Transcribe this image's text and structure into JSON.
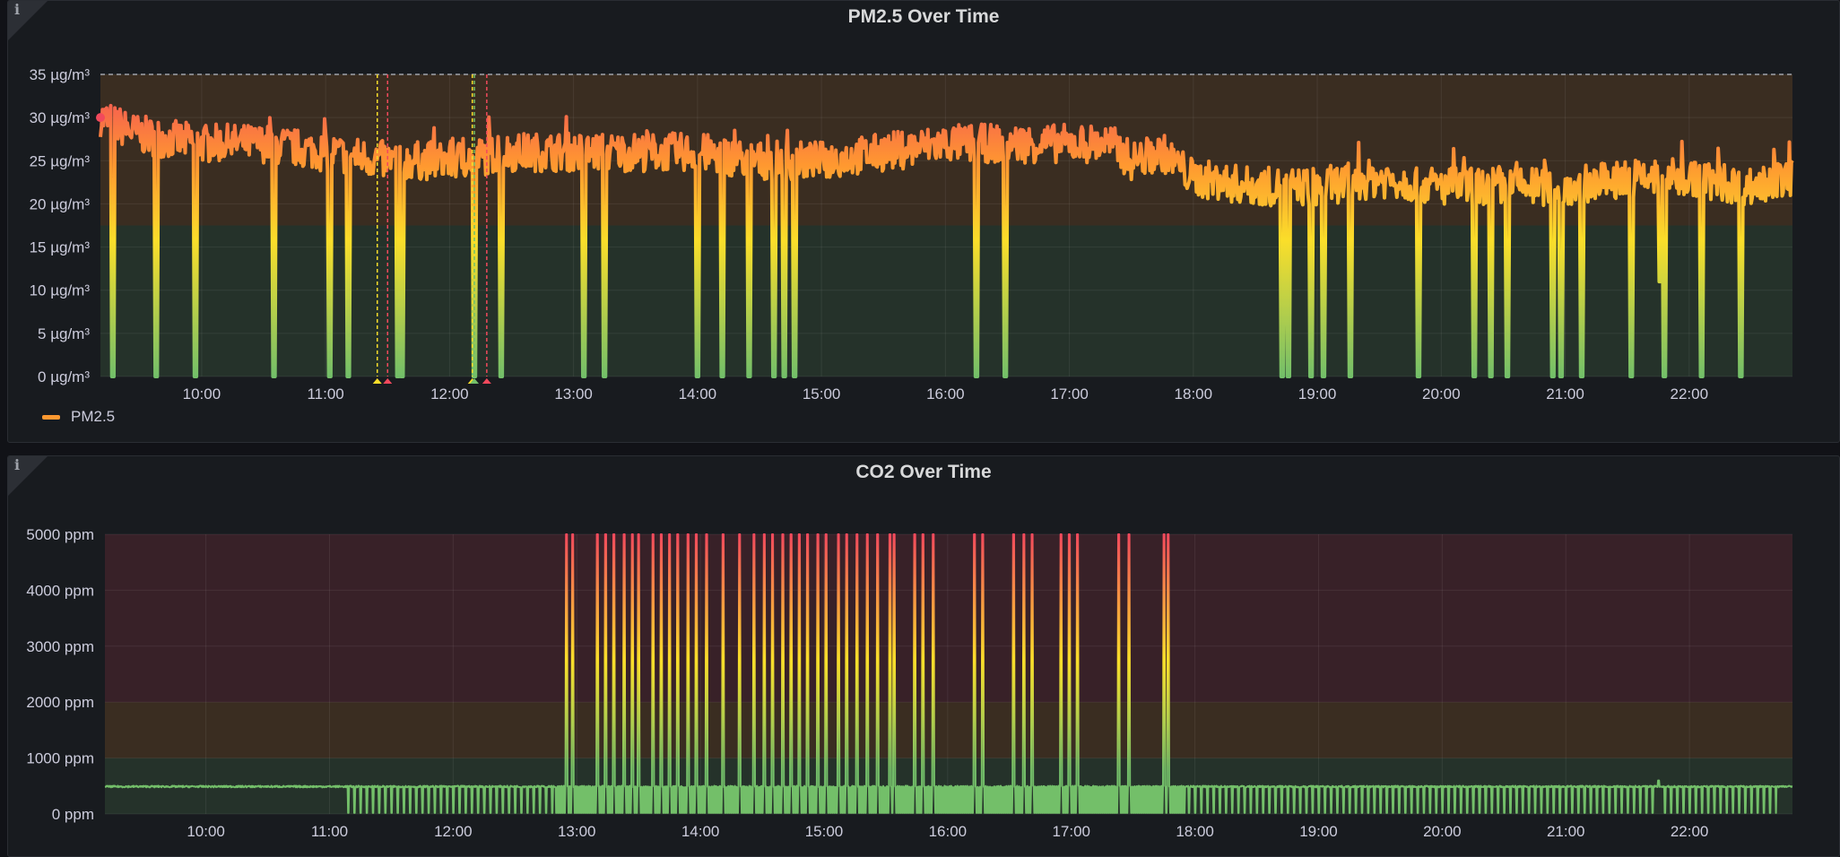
{
  "colors": {
    "panel_bg": "#181b1f",
    "text": "#ccccdc",
    "pm25_series": "#ff9830",
    "pm25_high": "#f2495c",
    "pm25_mid": "#ff9830",
    "pm25_low": "#fade2a",
    "pm25_base": "#73bf69",
    "co2_line": "#73bf69",
    "co2_spike": "#f2495c",
    "annotation_yellow": "#fade2a",
    "annotation_red": "#f2495c",
    "annotation_green": "#73bf69"
  },
  "panels": {
    "pm25": {
      "title": "PM2.5 Over Time",
      "info_icon": "i",
      "legend_label": "PM2.5"
    },
    "co2": {
      "title": "CO2 Over Time",
      "info_icon": "i"
    }
  },
  "chart_data": [
    {
      "type": "line",
      "title": "PM2.5 Over Time",
      "x_ticks": [
        "10:00",
        "11:00",
        "12:00",
        "13:00",
        "14:00",
        "15:00",
        "16:00",
        "17:00",
        "18:00",
        "19:00",
        "20:00",
        "21:00",
        "22:00"
      ],
      "x_range": [
        "09:11",
        "22:50"
      ],
      "ylim": [
        0,
        35
      ],
      "y_ticks": [
        "0 µg/m³",
        "5 µg/m³",
        "10 µg/m³",
        "15 µg/m³",
        "20 µg/m³",
        "25 µg/m³",
        "30 µg/m³",
        "35 µg/m³"
      ],
      "threshold_bands": [
        {
          "from": 0,
          "to": 17.5,
          "color": "#73bf69"
        },
        {
          "from": 17.5,
          "to": 35,
          "color": "#ff9830"
        }
      ],
      "threshold_line": 35,
      "legend": "bottom-left",
      "series": [
        {
          "name": "PM2.5",
          "color": "#ff9830",
          "baseline": [
            [
              "09:11",
              30
            ],
            [
              "09:30",
              28
            ],
            [
              "10:00",
              27
            ],
            [
              "10:30",
              27
            ],
            [
              "11:00",
              26
            ],
            [
              "11:30",
              25
            ],
            [
              "12:00",
              25
            ],
            [
              "12:30",
              26
            ],
            [
              "13:00",
              26
            ],
            [
              "13:30",
              26
            ],
            [
              "14:00",
              26
            ],
            [
              "14:30",
              25
            ],
            [
              "15:00",
              25
            ],
            [
              "15:30",
              26
            ],
            [
              "16:00",
              27
            ],
            [
              "16:30",
              27
            ],
            [
              "17:00",
              27
            ],
            [
              "17:20",
              27
            ],
            [
              "17:30",
              25
            ],
            [
              "17:45",
              26
            ],
            [
              "18:00",
              23
            ],
            [
              "18:30",
              22
            ],
            [
              "19:00",
              22
            ],
            [
              "19:30",
              23
            ],
            [
              "20:00",
              22
            ],
            [
              "20:30",
              22
            ],
            [
              "21:00",
              22
            ],
            [
              "21:30",
              23
            ],
            [
              "22:00",
              23
            ],
            [
              "22:30",
              22
            ],
            [
              "22:50",
              23
            ]
          ],
          "dropouts": [
            "09:17",
            "09:38",
            "09:57",
            "10:35",
            "11:02",
            "11:11",
            "11:35",
            "11:37",
            "12:12",
            "12:25",
            "13:05",
            "13:15",
            "14:00",
            "14:12",
            "14:25",
            "14:37",
            "14:42",
            "14:47",
            "16:15",
            "16:29",
            "18:43",
            "18:46",
            "18:57",
            "19:03",
            "19:16",
            "19:49",
            "20:16",
            "20:24",
            "20:32",
            "20:54",
            "20:58",
            "21:08",
            "21:32",
            "21:48",
            "22:06",
            "22:25"
          ],
          "partial_dips": [
            [
              "21:46",
              11
            ]
          ]
        }
      ],
      "annotations": [
        {
          "time": "11:25",
          "color": "#fade2a"
        },
        {
          "time": "11:30",
          "color": "#f2495c"
        },
        {
          "time": "12:11",
          "color": "#fade2a"
        },
        {
          "time": "12:12",
          "color": "#73bf69"
        },
        {
          "time": "12:18",
          "color": "#f2495c"
        }
      ]
    },
    {
      "type": "line",
      "title": "CO2 Over Time",
      "x_ticks": [
        "10:00",
        "11:00",
        "12:00",
        "13:00",
        "14:00",
        "15:00",
        "16:00",
        "17:00",
        "18:00",
        "19:00",
        "20:00",
        "21:00",
        "22:00"
      ],
      "x_range": [
        "09:11",
        "22:50"
      ],
      "ylim": [
        0,
        5000
      ],
      "y_ticks": [
        "0 ppm",
        "1000 ppm",
        "2000 ppm",
        "3000 ppm",
        "4000 ppm",
        "5000 ppm"
      ],
      "threshold_bands": [
        {
          "from": 0,
          "to": 1000,
          "color": "#73bf69"
        },
        {
          "from": 1000,
          "to": 2000,
          "color": "#ff9830"
        },
        {
          "from": 2000,
          "to": 5000,
          "color": "#f2495c"
        }
      ],
      "series": [
        {
          "name": "",
          "color": "#73bf69",
          "baseline_ppm": 490,
          "dropout_period": [
            "11:08",
            "22:42"
          ],
          "spikes_to_5000": [
            "12:55",
            "12:58",
            "13:10",
            "13:14",
            "13:18",
            "13:23",
            "13:27",
            "13:30",
            "13:37",
            "13:41",
            "13:45",
            "13:49",
            "13:54",
            "13:58",
            "14:03",
            "14:11",
            "14:19",
            "14:26",
            "14:31",
            "14:35",
            "14:40",
            "14:44",
            "14:48",
            "14:52",
            "14:57",
            "15:01",
            "15:07",
            "15:11",
            "15:16",
            "15:21",
            "15:26",
            "15:32",
            "15:34",
            "15:44",
            "15:48",
            "15:53",
            "16:13",
            "16:17",
            "16:32",
            "16:37",
            "16:41",
            "16:55",
            "16:59",
            "17:03",
            "17:23",
            "17:28",
            "17:45",
            "17:47"
          ],
          "small_spikes": [
            [
              "21:45",
              600
            ]
          ]
        }
      ]
    }
  ]
}
